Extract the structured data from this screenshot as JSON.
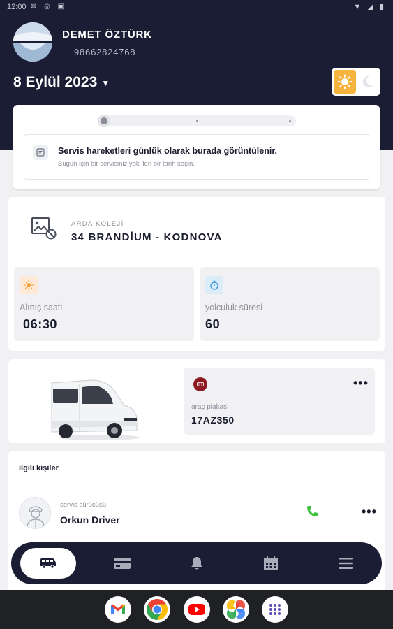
{
  "status_bar": {
    "time": "12:00"
  },
  "user": {
    "name": "DEMET ÖZTÜRK",
    "phone": "98662824768"
  },
  "date_selector": {
    "label": "8 Eylül 2023"
  },
  "notice": {
    "title": "Servis hareketleri günlük olarak burada görüntülenir.",
    "subtitle": "Bugün için bir servisiniz yok ileri bir tarih seçin."
  },
  "route": {
    "school": "ARDA KOLEJİ",
    "name": "34 BRANDİUM - KODNOVA",
    "pickup": {
      "label": "Alınış saati",
      "value": "06:30"
    },
    "duration": {
      "label": "yolculuk süresi",
      "value": "60"
    }
  },
  "vehicle": {
    "plate_label": "araç plakası",
    "plate": "17AZ350",
    "more": "•••"
  },
  "contacts": {
    "title": "ilgili kişiler",
    "driver": {
      "role": "servis sürücüsü",
      "name": "Orkun Driver",
      "more": "•••"
    }
  },
  "bottom_nav": [
    "bus-icon",
    "card-icon",
    "bell-icon",
    "calendar-icon",
    "menu-icon"
  ],
  "system_apps": [
    "gmail-icon",
    "chrome-icon",
    "youtube-icon",
    "photos-icon",
    "app-drawer-icon"
  ],
  "colors": {
    "navy": "#1b1d35",
    "sun": "#f6b33d",
    "call_green": "#3cc23c"
  }
}
